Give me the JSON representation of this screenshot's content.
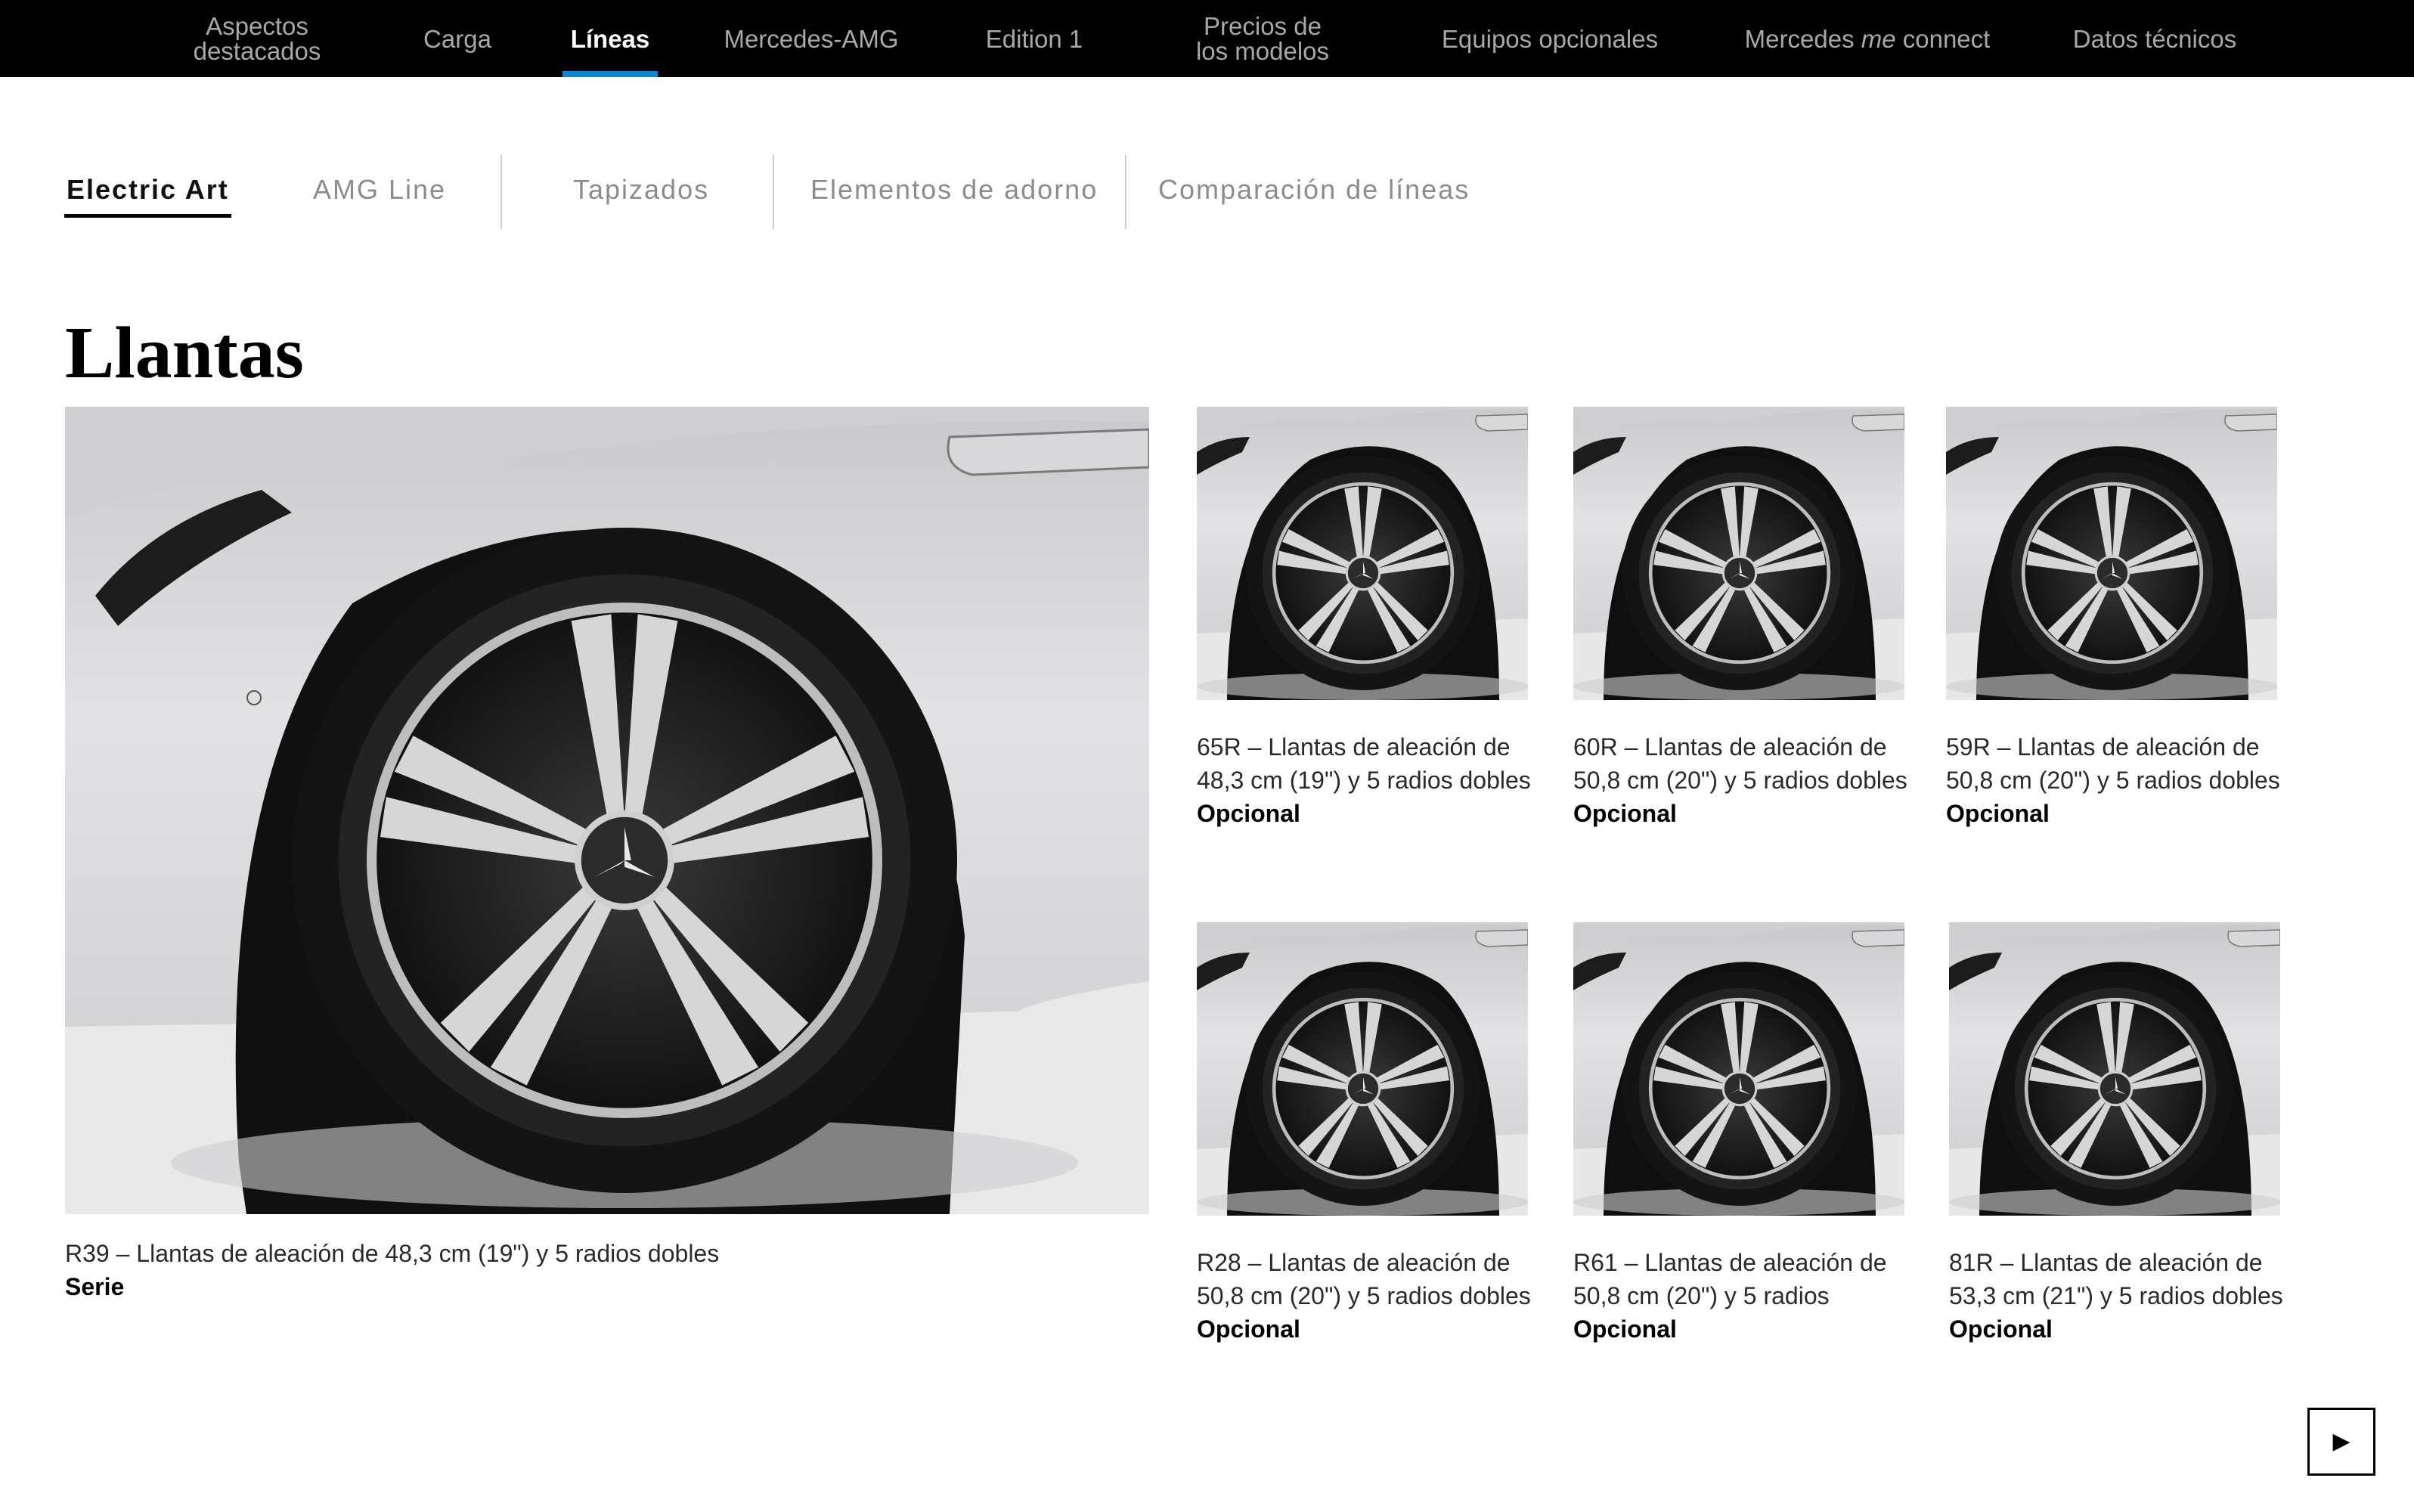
{
  "topnav": {
    "items": [
      {
        "line1": "Aspectos",
        "line2": "destacados"
      },
      {
        "label": "Carga"
      },
      {
        "label": "Líneas",
        "active": true
      },
      {
        "label": "Mercedes-AMG"
      },
      {
        "label": "Edition 1"
      },
      {
        "line1": "Precios de",
        "line2": "los modelos"
      },
      {
        "label": "Equipos opcionales"
      },
      {
        "prefix": "Mercedes ",
        "italic": "me",
        "suffix": " connect"
      },
      {
        "label": "Datos técnicos"
      }
    ],
    "accent_color": "#0a86d6"
  },
  "subtabs": [
    {
      "label": "Electric Art",
      "active": true
    },
    {
      "label": "AMG Line"
    },
    {
      "label": "Tapizados"
    },
    {
      "label": "Elementos de adorno"
    },
    {
      "label": "Comparación de líneas"
    }
  ],
  "section": {
    "title": "Llantas"
  },
  "wheels": [
    {
      "code_desc": "R39 – Llantas de aleación de 48,3 cm (19\") y 5 radios dobles",
      "status": "Serie",
      "icon": "wheel-photo"
    },
    {
      "line1": "65R – Llantas de aleación de",
      "line2": "48,3 cm (19\") y 5 radios dobles",
      "status": "Opcional",
      "icon": "wheel-photo"
    },
    {
      "line1": "60R – Llantas de aleación de",
      "line2": "50,8 cm (20\") y 5 radios dobles",
      "status": "Opcional",
      "icon": "wheel-photo"
    },
    {
      "line1": "59R – Llantas de aleación de",
      "line2": "50,8 cm (20\") y 5 radios dobles",
      "status": "Opcional",
      "icon": "wheel-photo"
    },
    {
      "line1": "R28 – Llantas de aleación de",
      "line2": "50,8 cm (20\") y 5 radios dobles",
      "status": "Opcional",
      "icon": "wheel-photo"
    },
    {
      "line1": "R61 – Llantas de aleación de",
      "line2": "50,8 cm (20\") y 5 radios",
      "status": "Opcional",
      "icon": "wheel-photo"
    },
    {
      "line1": "81R – Llantas de aleación de",
      "line2": "53,3 cm (21\") y 5 radios dobles",
      "status": "Opcional",
      "icon": "wheel-photo"
    }
  ],
  "next_button": {
    "glyph": "▶",
    "icon": "play-next-icon"
  }
}
